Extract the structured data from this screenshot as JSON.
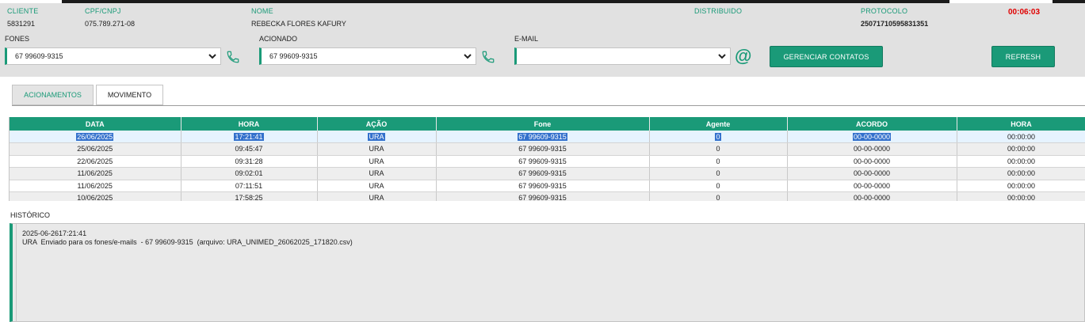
{
  "header": {
    "cliente": {
      "label": "CLIENTE",
      "value": "5831291"
    },
    "cpf": {
      "label": "CPF/CNPJ",
      "value": "075.789.271-08"
    },
    "nome": {
      "label": "NOME",
      "value": "REBECKA FLORES KAFURY"
    },
    "distribuido": {
      "label": "DISTRIBUIDO",
      "value": ""
    },
    "protocolo": {
      "label": "PROTOCOLO",
      "value": "25071710595831351"
    },
    "timer": "00:06:03"
  },
  "contacts": {
    "fones": {
      "label": "FONES",
      "value": "67 99609-9315"
    },
    "acionado": {
      "label": "ACIONADO",
      "value": "67 99609-9315"
    },
    "email": {
      "label": "E-MAIL",
      "value": ""
    },
    "at_symbol": "@",
    "gerenciar_label": "GERENCIAR CONTATOS",
    "refresh_label": "REFRESH"
  },
  "tabs": [
    {
      "label": "ACIONAMENTOS",
      "active": true
    },
    {
      "label": "MOVIMENTO",
      "active": false
    }
  ],
  "grid": {
    "columns": [
      "DATA",
      "HORA",
      "AÇÃO",
      "Fone",
      "Agente",
      "ACORDO",
      "HORA"
    ],
    "rows": [
      [
        "26/06/2025",
        "17:21:41",
        "URA",
        "67 99609-9315",
        "0",
        "00-00-0000",
        "00:00:00"
      ],
      [
        "25/06/2025",
        "09:45:47",
        "URA",
        "67 99609-9315",
        "0",
        "00-00-0000",
        "00:00:00"
      ],
      [
        "22/06/2025",
        "09:31:28",
        "URA",
        "67 99609-9315",
        "0",
        "00-00-0000",
        "00:00:00"
      ],
      [
        "11/06/2025",
        "09:02:01",
        "URA",
        "67 99609-9315",
        "0",
        "00-00-0000",
        "00:00:00"
      ],
      [
        "11/06/2025",
        "07:11:51",
        "URA",
        "67 99609-9315",
        "0",
        "00-00-0000",
        "00:00:00"
      ],
      [
        "10/06/2025",
        "17:58:25",
        "URA",
        "67 99609-9315",
        "0",
        "00-00-0000",
        "00:00:00"
      ]
    ],
    "selected_row": 0
  },
  "historico": {
    "label": "HISTÓRICO",
    "lines": [
      "2025-06-2617:21:41",
      "URA  Enviado para os fones/e-mails  - 67 99609-9315  (arquivo: URA_UNIMED_26062025_171820.csv)"
    ]
  },
  "colors": {
    "accent": "#1a9a78",
    "timer": "#e00000",
    "selection": "#3370cc"
  }
}
